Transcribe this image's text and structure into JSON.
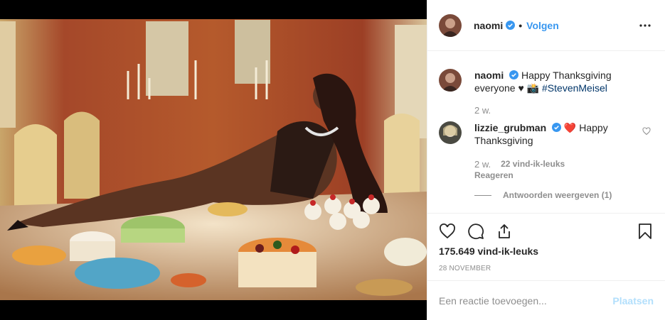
{
  "post": {
    "username": "naomi",
    "follow_label": "Volgen",
    "separator": "•",
    "image_alt": "Naomi reclining on a banquet table covered with cakes and pastries",
    "more_icon": "more-horizontal-icon"
  },
  "caption": {
    "username": "naomi",
    "text": "Happy Thanksgiving everyone",
    "hashtag": "#StevenMeisel",
    "emojis": "♥ 📸",
    "time": "2 w."
  },
  "comment": {
    "username": "lizzie_grubman",
    "emoji": "❤️",
    "text": "Happy Thanksgiving",
    "time": "2 w.",
    "likes": "22 vind-ik-leuks",
    "reply_label": "Reageren",
    "view_replies": "Antwoorden weergeven (1)"
  },
  "actions": {
    "like_icon": "heart-icon",
    "comment_icon": "comment-icon",
    "share_icon": "share-icon",
    "save_icon": "bookmark-icon"
  },
  "likes_count": "175.649 vind-ik-leuks",
  "date": "28 NOVEMBER",
  "add_comment": {
    "placeholder": "Een reactie toevoegen...",
    "post_label": "Plaatsen"
  },
  "colors": {
    "link_blue": "#3897f0",
    "hashtag_blue": "#003569",
    "muted": "#8e8e8e",
    "disabled_blue": "#b2dffc",
    "heart_red": "#ed4956"
  }
}
